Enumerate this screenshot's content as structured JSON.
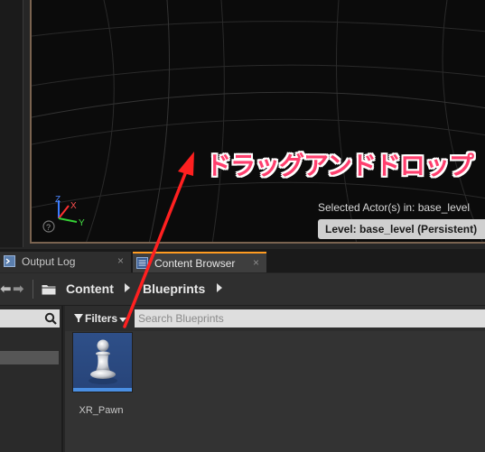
{
  "viewport": {
    "selected_actors": "Selected Actor(s) in:  base_level",
    "level_label": "Level:  base_level (Persistent)",
    "axis_labels": {
      "z": "Z",
      "x": "X",
      "y": "Y"
    },
    "help_icon": "?"
  },
  "annotation": {
    "text": "ドラッグアンドドロップ",
    "color": "#ff3f6e"
  },
  "tabs": [
    {
      "label": "Output Log",
      "icon": "output-log-icon",
      "close": "×",
      "active": false
    },
    {
      "label": "Content Browser",
      "icon": "content-browser-icon",
      "close": "×",
      "active": true
    }
  ],
  "path_bar": {
    "back": "⬅",
    "forward": "➡",
    "crumbs": [
      "Content",
      "Blueprints"
    ]
  },
  "filters": {
    "label": "Filters"
  },
  "search": {
    "placeholder": "Search Blueprints"
  },
  "assets": [
    {
      "name": "XR_Pawn",
      "icon": "pawn-icon"
    }
  ],
  "colors": {
    "accent_tab": "#ff9b21",
    "asset_selection": "#4a8fe3",
    "annotation_arrow": "#ff2020"
  }
}
